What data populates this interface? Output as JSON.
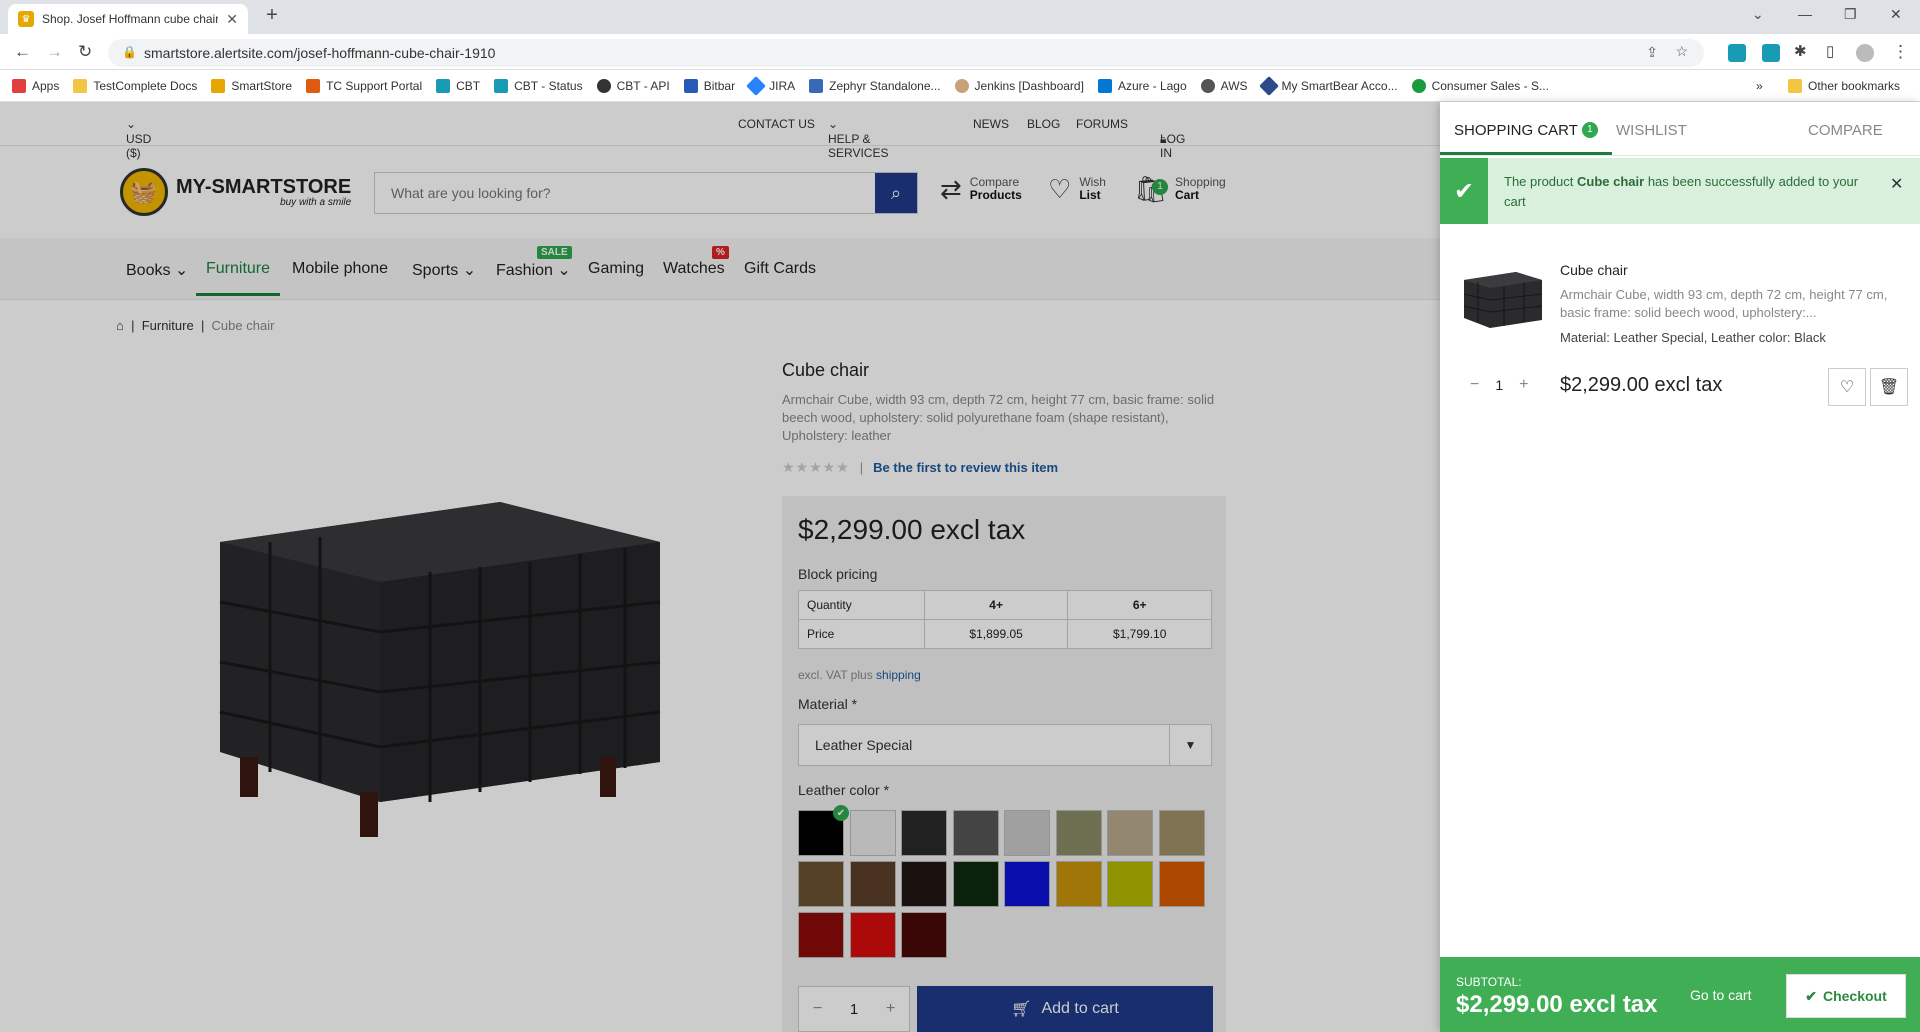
{
  "browser": {
    "tab_title": "Shop. Josef Hoffmann cube chair",
    "url": "smartstore.alertsite.com/josef-hoffmann-cube-chair-1910",
    "bookmarks": [
      "Apps",
      "TestComplete Docs",
      "SmartStore",
      "TC Support Portal",
      "CBT",
      "CBT - Status",
      "CBT - API",
      "Bitbar",
      "JIRA",
      "Zephyr Standalone...",
      "Jenkins [Dashboard]",
      "Azure - Lago",
      "AWS",
      "My SmartBear Acco...",
      "Consumer Sales - S..."
    ],
    "more_bookmarks": "»",
    "other_bookmarks": "Other bookmarks"
  },
  "topbar": {
    "currency": "USD ($)",
    "contact": "CONTACT US",
    "help": "HELP & SERVICES",
    "news": "NEWS",
    "blog": "BLOG",
    "forums": "FORUMS",
    "login": "LOG IN"
  },
  "header": {
    "logo_title": "MY-SMARTSTORE",
    "logo_sub": "buy with a smile",
    "search_placeholder": "What are you looking for?",
    "compare_top": "Compare",
    "compare_bottom": "Products",
    "wish_top": "Wish",
    "wish_bottom": "List",
    "cart_top": "Shopping",
    "cart_bottom": "Cart",
    "cart_count": "1"
  },
  "menu": {
    "items": [
      "Books",
      "Furniture",
      "Mobile phone",
      "Sports",
      "Fashion",
      "Gaming",
      "Watches",
      "Gift Cards"
    ],
    "sale_badge": "SALE",
    "pct_badge": "%"
  },
  "breadcrumb": {
    "category": "Furniture",
    "current": "Cube chair"
  },
  "product": {
    "name": "Cube chair",
    "description": "Armchair Cube, width 93 cm, depth 72 cm, height 77 cm, basic frame: solid beech wood, upholstery: solid polyurethane foam (shape resistant), Upholstery: leather",
    "review_link": "Be the first to review this item",
    "price": "$2,299.00 excl tax",
    "block_pricing_label": "Block pricing",
    "table": {
      "row1": [
        "Quantity",
        "4+",
        "6+"
      ],
      "row2": [
        "Price",
        "$1,899.05",
        "$1,799.10"
      ]
    },
    "vat_text": "excl. VAT plus",
    "shipping_link": "shipping",
    "material_label": "Material *",
    "material_value": "Leather Special",
    "color_label": "Leather color *",
    "colors": [
      "#000000",
      "#e8e8e8",
      "#2a2a2a",
      "#555555",
      "#c8c8c8",
      "#8a8a66",
      "#b9a98e",
      "#a0906a",
      "#6b5230",
      "#5a3e28",
      "#221612",
      "#0d2a10",
      "#0c12d8",
      "#c8940c",
      "#b3b800",
      "#d85a00",
      "#8c0a0a",
      "#d80c0c",
      "#4a0808"
    ],
    "quantity": "1",
    "add_to_cart": "Add to cart"
  },
  "panel": {
    "tab_cart": "SHOPPING CART",
    "cart_count": "1",
    "tab_wishlist": "WISHLIST",
    "tab_compare": "COMPARE",
    "notice_prefix": "The product",
    "notice_product": "Cube chair",
    "notice_suffix": "has been successfully added to your cart",
    "item_name": "Cube chair",
    "item_desc": "Armchair Cube, width 93 cm, depth 72 cm, height 77 cm, basic frame: solid beech wood, upholstery:...",
    "item_attr": "Material: Leather Special, Leather color: Black",
    "item_qty": "1",
    "item_price": "$2,299.00 excl tax",
    "subtotal_label": "SUBTOTAL:",
    "subtotal_value": "$2,299.00 excl tax",
    "go_to_cart": "Go to cart",
    "checkout": "Checkout"
  }
}
